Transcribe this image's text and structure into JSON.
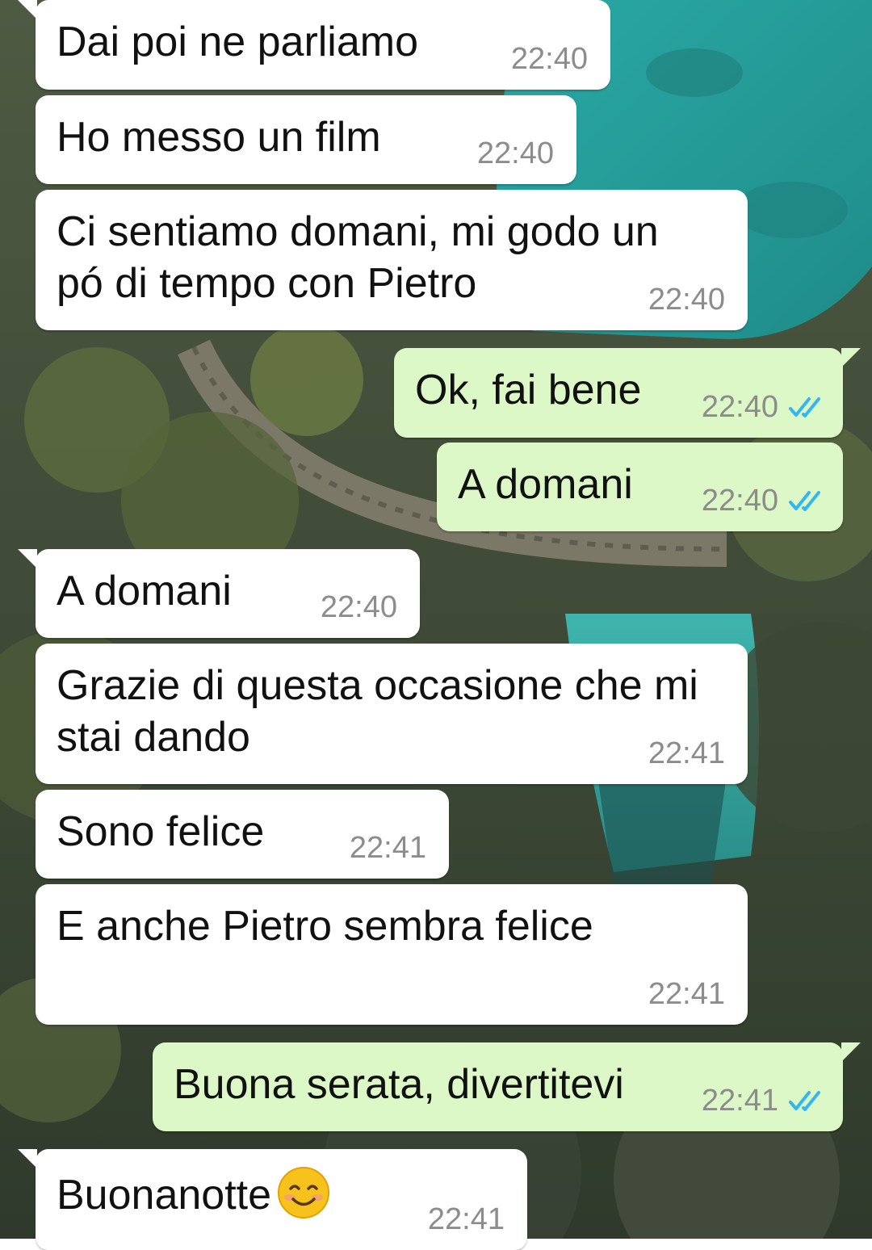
{
  "chat": {
    "messages": [
      {
        "direction": "in",
        "text": "Dai poi ne parliamo",
        "time": "22:40"
      },
      {
        "direction": "in",
        "text": "Ho messo un film",
        "time": "22:40"
      },
      {
        "direction": "in",
        "text": "Ci sentiamo domani, mi godo un pó di tempo con Pietro",
        "time": "22:40"
      },
      {
        "direction": "out",
        "text": "Ok, fai bene",
        "time": "22:40",
        "status": "read"
      },
      {
        "direction": "out",
        "text": "A domani",
        "time": "22:40",
        "status": "read"
      },
      {
        "direction": "in",
        "text": "A domani",
        "time": "22:40"
      },
      {
        "direction": "in",
        "text": "Grazie di questa occasione che mi stai dando",
        "time": "22:41"
      },
      {
        "direction": "in",
        "text": "Sono felice",
        "time": "22:41"
      },
      {
        "direction": "in",
        "text": "E anche Pietro sembra felice",
        "time": "22:41"
      },
      {
        "direction": "out",
        "text": "Buona serata, divertitevi",
        "time": "22:41",
        "status": "read"
      },
      {
        "direction": "in",
        "text": "Buonanotte",
        "emoji": "smiling-face-emoji",
        "time": "22:41"
      }
    ]
  },
  "colors": {
    "incoming_bubble": "#ffffff",
    "outgoing_bubble": "#dcf8c6",
    "timestamp": "#8c8c8c",
    "read_ticks": "#34b7f1"
  },
  "icons": {
    "read_status": "double-check-icon"
  }
}
